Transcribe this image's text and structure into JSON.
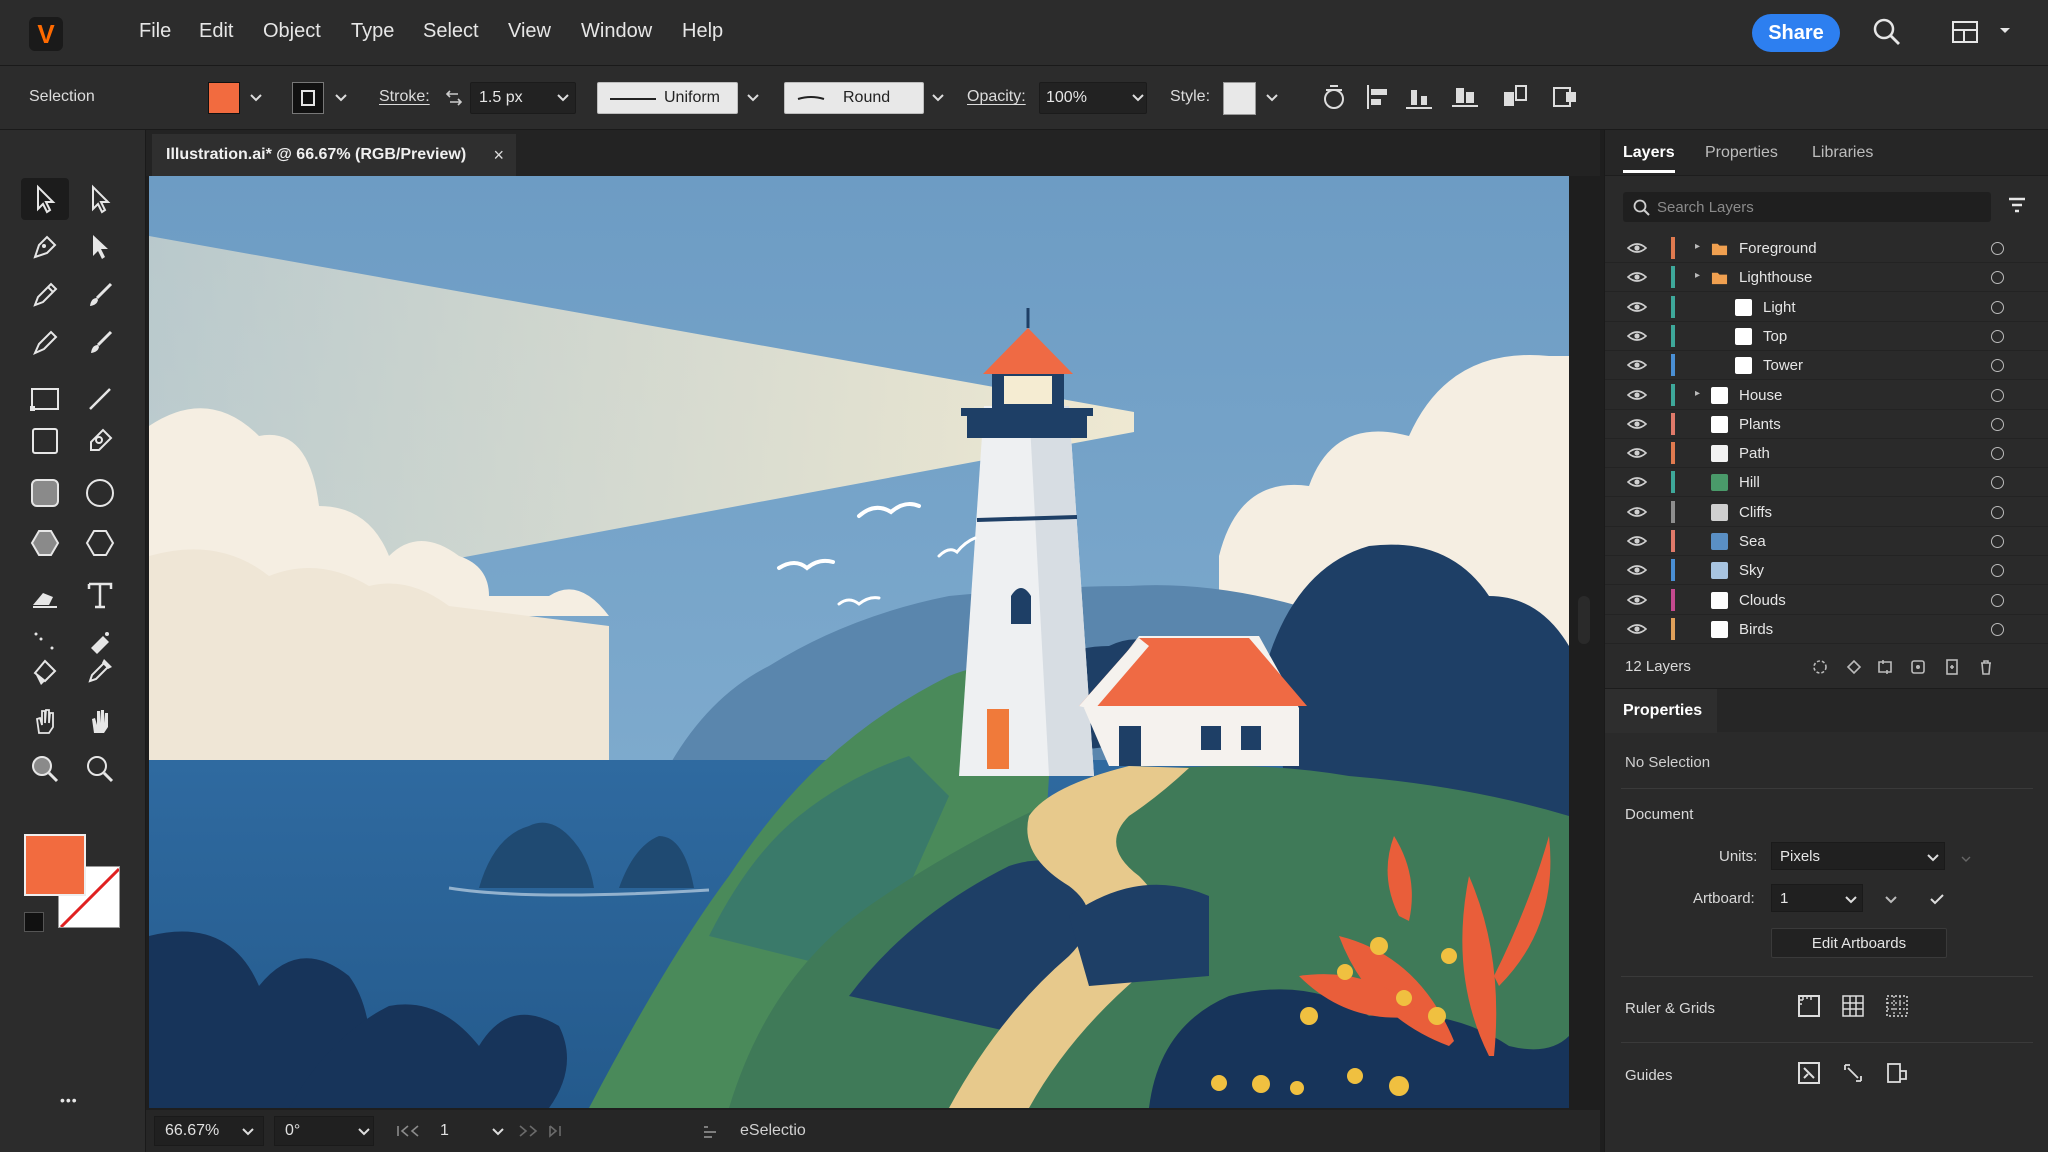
{
  "app": {
    "logo_letter": "V",
    "menu": [
      "File",
      "Edit",
      "Object",
      "Type",
      "Select",
      "View",
      "Window",
      "Help"
    ],
    "share_label": "Share"
  },
  "control_bar": {
    "selection_label": "Selection",
    "fill_color": "#f26b3f",
    "stroke_label": "Stroke:",
    "stroke_weight": "1.5 px",
    "profile": "Uniform",
    "brush": "Round",
    "opacity_label": "Opacity:",
    "opacity": "100%",
    "style_label": "Style:"
  },
  "document": {
    "tab_title": "Illustration.ai* @ 66.67% (RGB/Preview)",
    "close_glyph": "×"
  },
  "status_bar": {
    "zoom": "66.67%",
    "rotation": "0°",
    "artboard": "1",
    "tool_text": "eSelectio"
  },
  "toolbar": {
    "fill_swatch": "#f26b3f",
    "more_glyph": "•••"
  },
  "panel": {
    "tabs": [
      "Layers",
      "Properties",
      "Libraries"
    ],
    "search_placeholder": "Search Layers",
    "layers": [
      {
        "name": "Foreground",
        "color": "#e07a4f",
        "thumb": "#f0a050",
        "twirl": true,
        "indent": 0,
        "folder": true
      },
      {
        "name": "Lighthouse",
        "color": "#3ea89a",
        "thumb": "#f0a050",
        "twirl": true,
        "indent": 0,
        "folder": true
      },
      {
        "name": "Light",
        "color": "#3ea89a",
        "thumb": "#ffffff",
        "twirl": false,
        "indent": 1,
        "folder": false
      },
      {
        "name": "Top",
        "color": "#3ea89a",
        "thumb": "#ffffff",
        "twirl": false,
        "indent": 1,
        "folder": false
      },
      {
        "name": "Tower",
        "color": "#4a8fd4",
        "thumb": "#ffffff",
        "twirl": false,
        "indent": 1,
        "folder": false
      },
      {
        "name": "House",
        "color": "#3ea89a",
        "thumb": "#ffffff",
        "twirl": true,
        "indent": 0,
        "folder": false
      },
      {
        "name": "Plants",
        "color": "#e07a6a",
        "thumb": "#ffffff",
        "twirl": false,
        "indent": 0,
        "folder": false
      },
      {
        "name": "Path",
        "color": "#e07a4f",
        "thumb": "#f2f2f2",
        "twirl": false,
        "indent": 0,
        "folder": false
      },
      {
        "name": "Hill",
        "color": "#3ea89a",
        "thumb": "#4a9a6a",
        "twirl": false,
        "indent": 0,
        "folder": false
      },
      {
        "name": "Cliffs",
        "color": "#8e8e8e",
        "thumb": "#cfcfcf",
        "twirl": false,
        "indent": 0,
        "folder": false
      },
      {
        "name": "Sea",
        "color": "#e07a6a",
        "thumb": "#5a8fc4",
        "twirl": false,
        "indent": 0,
        "folder": false
      },
      {
        "name": "Sky",
        "color": "#4a8fd4",
        "thumb": "#a8c4e0",
        "twirl": false,
        "indent": 0,
        "folder": false
      },
      {
        "name": "Clouds",
        "color": "#c44a8f",
        "thumb": "#ffffff",
        "twirl": false,
        "indent": 0,
        "folder": false
      },
      {
        "name": "Birds",
        "color": "#e0a05a",
        "thumb": "#ffffff",
        "twirl": false,
        "indent": 0,
        "folder": false
      }
    ],
    "layer_count": "12 Layers",
    "properties": {
      "title": "Properties",
      "no_selection": "No Selection",
      "document_label": "Document",
      "units_label": "Units:",
      "units_value": "Pixels",
      "artboard_label": "Artboard:",
      "artboard_value": "1",
      "edit_artboards": "Edit Artboards",
      "ruler_grids": "Ruler & Grids",
      "guides": "Guides"
    }
  }
}
